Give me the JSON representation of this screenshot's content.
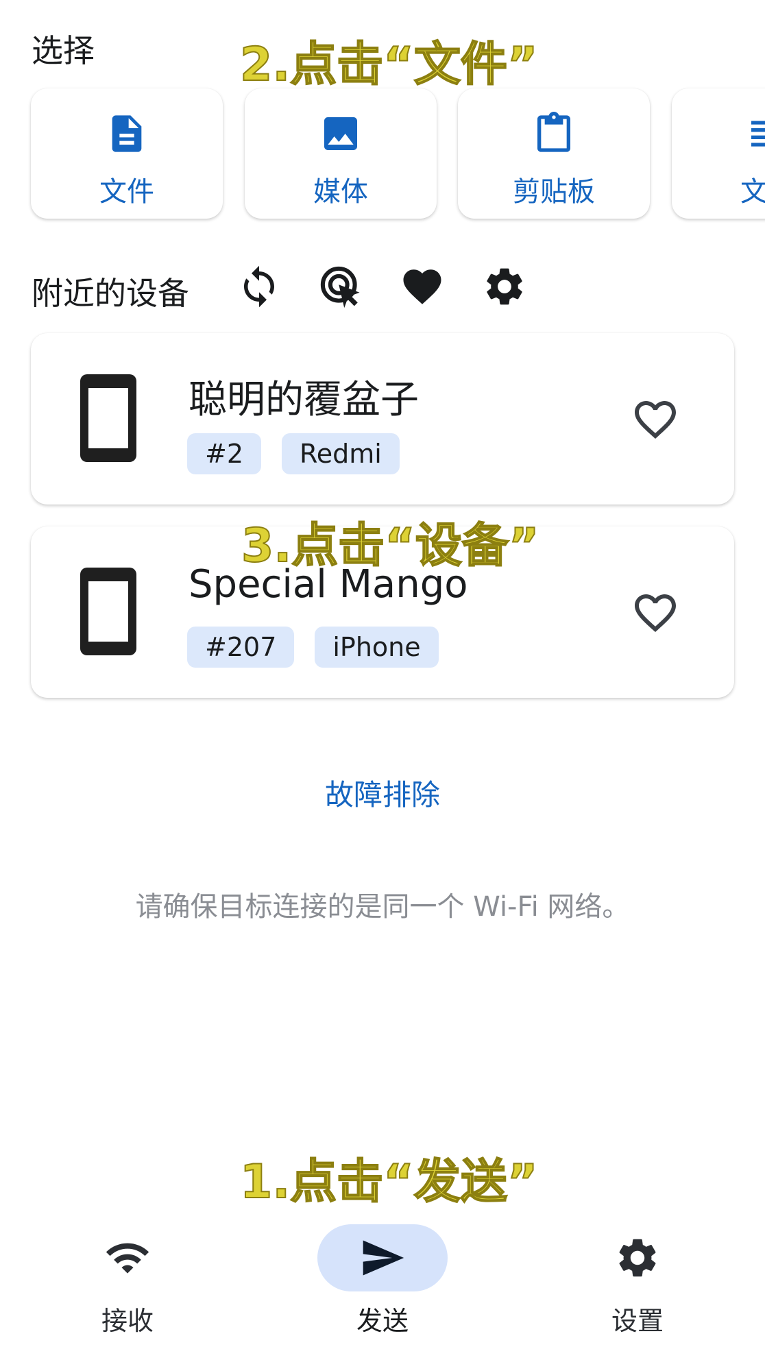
{
  "select": {
    "title": "选择",
    "cards": [
      {
        "label": "文件",
        "icon": "file-icon"
      },
      {
        "label": "媒体",
        "icon": "image-icon"
      },
      {
        "label": "剪贴板",
        "icon": "clipboard-icon"
      },
      {
        "label": "文本",
        "icon": "text-icon"
      }
    ]
  },
  "nearby": {
    "title": "附近的设备",
    "icons": [
      "refresh-icon",
      "scan-target-icon",
      "favorites-heart-icon",
      "settings-gear-icon"
    ]
  },
  "devices": [
    {
      "name": "聪明的覆盆子",
      "tags": [
        "#2",
        "Redmi"
      ],
      "icon": "phone-icon",
      "favorite_icon": "heart-outline-icon"
    },
    {
      "name": "Special Mango",
      "tags": [
        "#207",
        "iPhone"
      ],
      "icon": "phone-icon",
      "favorite_icon": "heart-outline-icon"
    }
  ],
  "troubleshoot_label": "故障排除",
  "hint": "请确保目标连接的是同一个 Wi-Fi 网络。",
  "annotations": {
    "step1": "1.点击“发送”",
    "step2": "2.点击“文件”",
    "step3": "3.点击“设备”"
  },
  "nav": {
    "items": [
      {
        "label": "接收",
        "icon": "wifi-icon",
        "active": false
      },
      {
        "label": "发送",
        "icon": "send-icon",
        "active": true
      },
      {
        "label": "设置",
        "icon": "settings-icon",
        "active": false
      }
    ]
  },
  "colors": {
    "accent": "#1565c0",
    "chip_bg": "#dce8fb",
    "active_pill": "#d6e3fb",
    "annotation": "#ddd235",
    "hint_text": "#8a8d93"
  }
}
